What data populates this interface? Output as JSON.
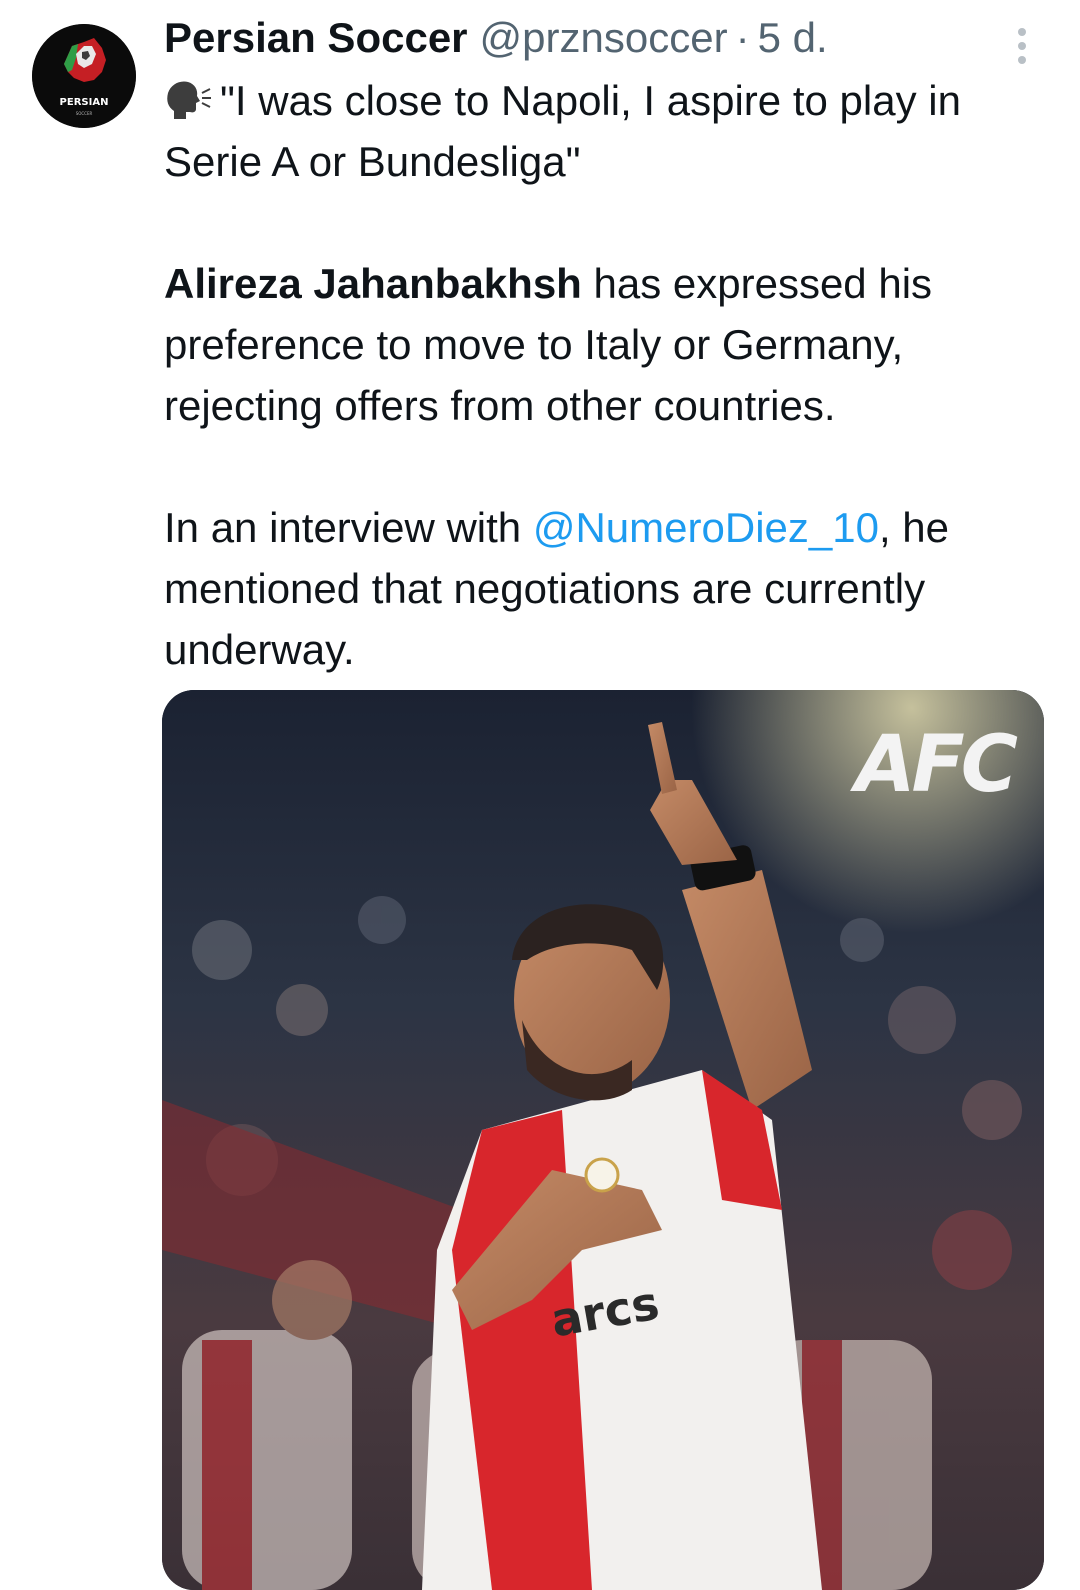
{
  "tweet": {
    "author": {
      "display_name": "Persian Soccer",
      "handle": "@prznsoccer",
      "separator": "·",
      "time": "5 d.",
      "avatar_text": "PERSIAN",
      "avatar_subtext": "SOCCER"
    },
    "icons": {
      "avatar": "persian-soccer-logo",
      "speaking": "speaking-head-icon",
      "more": "more-vertical-icon"
    },
    "text": {
      "quote": "\"I was close to Napoli, I aspire to play in Serie A or Bundesliga\"",
      "player_name": "Alireza Jahanbakhsh",
      "paragraph2_rest": " has expressed his preference to move to Italy or Germany, rejecting offers from other countries.",
      "paragraph3_start": "In an interview with ",
      "mention": "@NumeroDiez_10",
      "paragraph3_end": ", he mentioned that negotiations are currently underway."
    },
    "media": {
      "watermark": "AFC",
      "shirt_sponsor": "arcs"
    },
    "colors": {
      "link": "#1d9bf0",
      "secondary_text": "#536471",
      "primary_text": "#0f1419"
    }
  }
}
